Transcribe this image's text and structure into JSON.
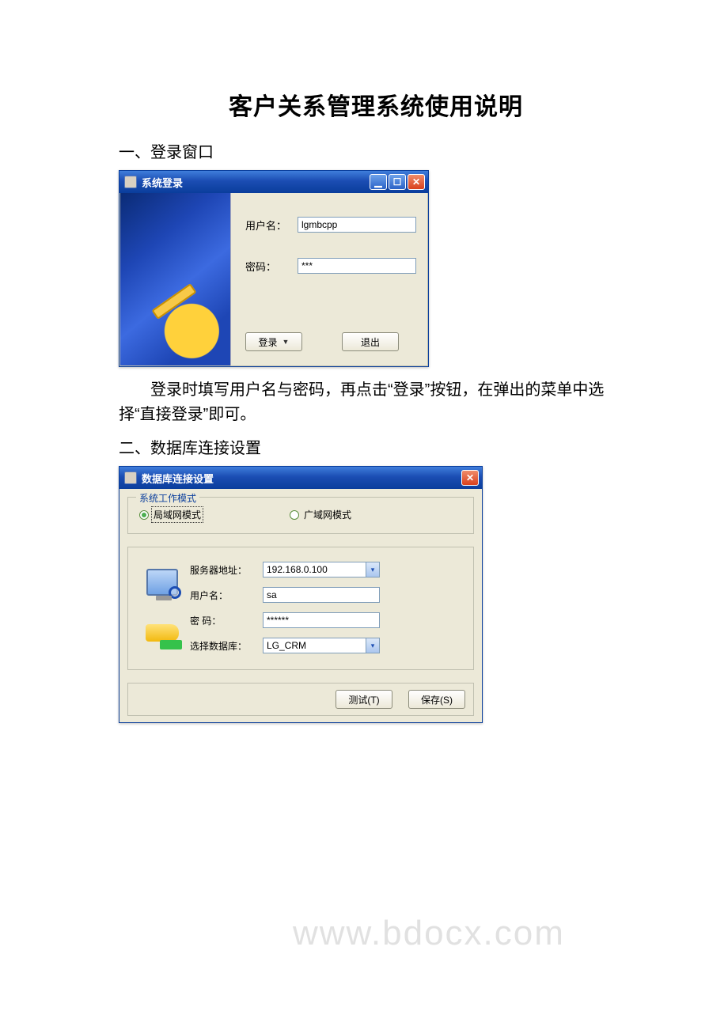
{
  "doc": {
    "title": "客户关系管理系统使用说明",
    "section1_heading": "一、登录窗口",
    "section1_body": "登录时填写用户名与密码，再点击“登录”按钮，在弹出的菜单中选择“直接登录”即可。",
    "section2_heading": "二、数据库连接设置",
    "watermark": "www.bdocx.com"
  },
  "login_window": {
    "title": "系统登录",
    "labels": {
      "username": "用户名：",
      "password": "密码："
    },
    "values": {
      "username": "lgmbcpp",
      "password": "***"
    },
    "buttons": {
      "login": "登录",
      "exit": "退出"
    },
    "dropdown_caret": "▼"
  },
  "db_window": {
    "title": "数据库连接设置",
    "group_mode_legend": "系统工作模式",
    "mode_options": {
      "lan": "局域网模式",
      "wan": "广域网模式"
    },
    "labels": {
      "server": "服务器地址：",
      "username": "用户名：",
      "password": "密  码：",
      "database": "选择数据库："
    },
    "values": {
      "server": "192.168.0.100",
      "username": "sa",
      "password": "******",
      "database": "LG_CRM"
    },
    "buttons": {
      "test": "测试(T)",
      "save": "保存(S)"
    }
  }
}
